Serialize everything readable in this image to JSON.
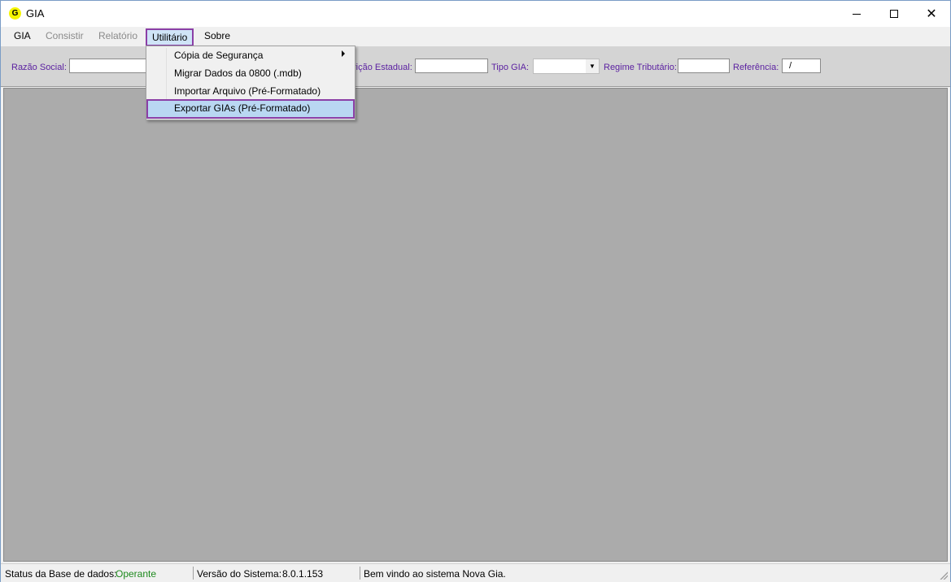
{
  "window": {
    "icon_letter": "G",
    "title": "GIA",
    "close_glyph": "✕"
  },
  "menubar": {
    "items": [
      {
        "label": "GIA",
        "state": "enabled"
      },
      {
        "label": "Consistir",
        "state": "disabled"
      },
      {
        "label": "Relatório",
        "state": "disabled"
      },
      {
        "label": "Utilitário",
        "state": "open"
      },
      {
        "label": "Sobre",
        "state": "enabled"
      }
    ]
  },
  "dropdown": {
    "items": [
      {
        "label": "Cópia de Segurança",
        "submenu": true
      },
      {
        "label": "Migrar Dados da 0800 (.mdb)",
        "submenu": false
      },
      {
        "label": "Importar Arquivo (Pré-Formatado)",
        "submenu": false
      },
      {
        "label": "Exportar GIAs (Pré-Formatado)",
        "submenu": false,
        "highlighted": true
      }
    ]
  },
  "toolbar": {
    "razao_social_label": "Razão Social:",
    "razao_social_value": "",
    "inscricao_label": "rição Estadual:",
    "inscricao_value": "",
    "tipo_gia_label": "Tipo GIA:",
    "tipo_gia_value": "",
    "regime_label": "Regime Tributário:",
    "regime_value": "",
    "referencia_label": "Referência:",
    "referencia_value": "/"
  },
  "statusbar": {
    "db_status_label": "Status da Base de dados:",
    "db_status_value": "Operante",
    "version_label": "Versão do Sistema:",
    "version_value": "8.0.1.153",
    "message": "Bem vindo ao sistema Nova Gia."
  },
  "colors": {
    "label_purple": "#5a1fa0",
    "highlight_border": "#8b3fa6",
    "highlight_fill": "#b9d7f2",
    "workspace_gray": "#ababab",
    "status_green": "#1e8a1e"
  }
}
